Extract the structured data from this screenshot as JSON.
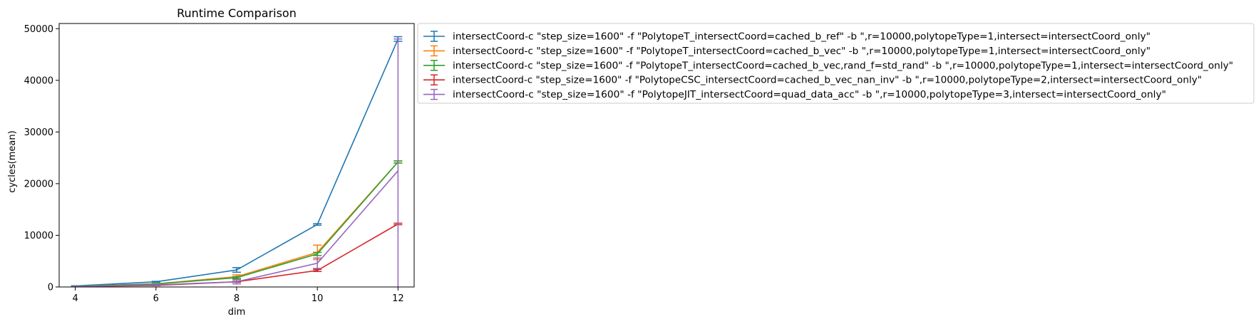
{
  "chart_data": {
    "type": "line",
    "title": "Runtime Comparison",
    "xlabel": "dim",
    "ylabel": "cycles(mean)",
    "xlim": [
      3.6,
      12.4
    ],
    "ylim": [
      0,
      51000
    ],
    "x_ticks": [
      4,
      6,
      8,
      10,
      12
    ],
    "y_ticks": [
      0,
      10000,
      20000,
      30000,
      40000,
      50000
    ],
    "grid": false,
    "legend_position": "outside-upper-right",
    "error_bars": true,
    "x": [
      4,
      6,
      8,
      10,
      12
    ],
    "series": [
      {
        "name": "intersectCoord-c \"step_size=1600\" -f \"PolytopeT_intersectCoord=cached_b_ref\" -b \",r=10000,polytopeType=1,intersect=intersectCoord_only\"",
        "color": "#1f77b4",
        "values": [
          200,
          1000,
          3300,
          12100,
          48000
        ],
        "errors": [
          40,
          90,
          450,
          150,
          450
        ]
      },
      {
        "name": "intersectCoord-c \"step_size=1600\" -f \"PolytopeT_intersectCoord=cached_b_vec\" -b \",r=10000,polytopeType=1,intersect=intersectCoord_only\"",
        "color": "#ff7f0e",
        "values": [
          150,
          600,
          2000,
          6700,
          24200
        ],
        "errors": [
          30,
          60,
          350,
          1400,
          200
        ]
      },
      {
        "name": "intersectCoord-c \"step_size=1600\" -f \"PolytopeT_intersectCoord=cached_b_vec,rand_f=std_rand\" -b \",r=10000,polytopeType=1,intersect=intersectCoord_only\"",
        "color": "#2ca02c",
        "values": [
          150,
          580,
          1800,
          6400,
          24200
        ],
        "errors": [
          30,
          60,
          200,
          300,
          200
        ]
      },
      {
        "name": "intersectCoord-c \"step_size=1600\" -f \"PolytopeCSC_intersectCoord=cached_b_vec_nan_inv\" -b \",r=10000,polytopeType=2,intersect=intersectCoord_only\"",
        "color": "#d62728",
        "values": [
          80,
          300,
          1000,
          3200,
          12200
        ],
        "errors": [
          20,
          40,
          80,
          200,
          150
        ]
      },
      {
        "name": "intersectCoord-c \"step_size=1600\" -f \"PolytopeJIT_intersectCoord=quad_data_acc\" -b \",r=10000,polytopeType=3,intersect=intersectCoord_only\"",
        "color": "#9467bd",
        "values": [
          100,
          400,
          1000,
          4600,
          22500
        ],
        "errors": [
          20,
          50,
          400,
          1000,
          25500
        ]
      }
    ]
  }
}
